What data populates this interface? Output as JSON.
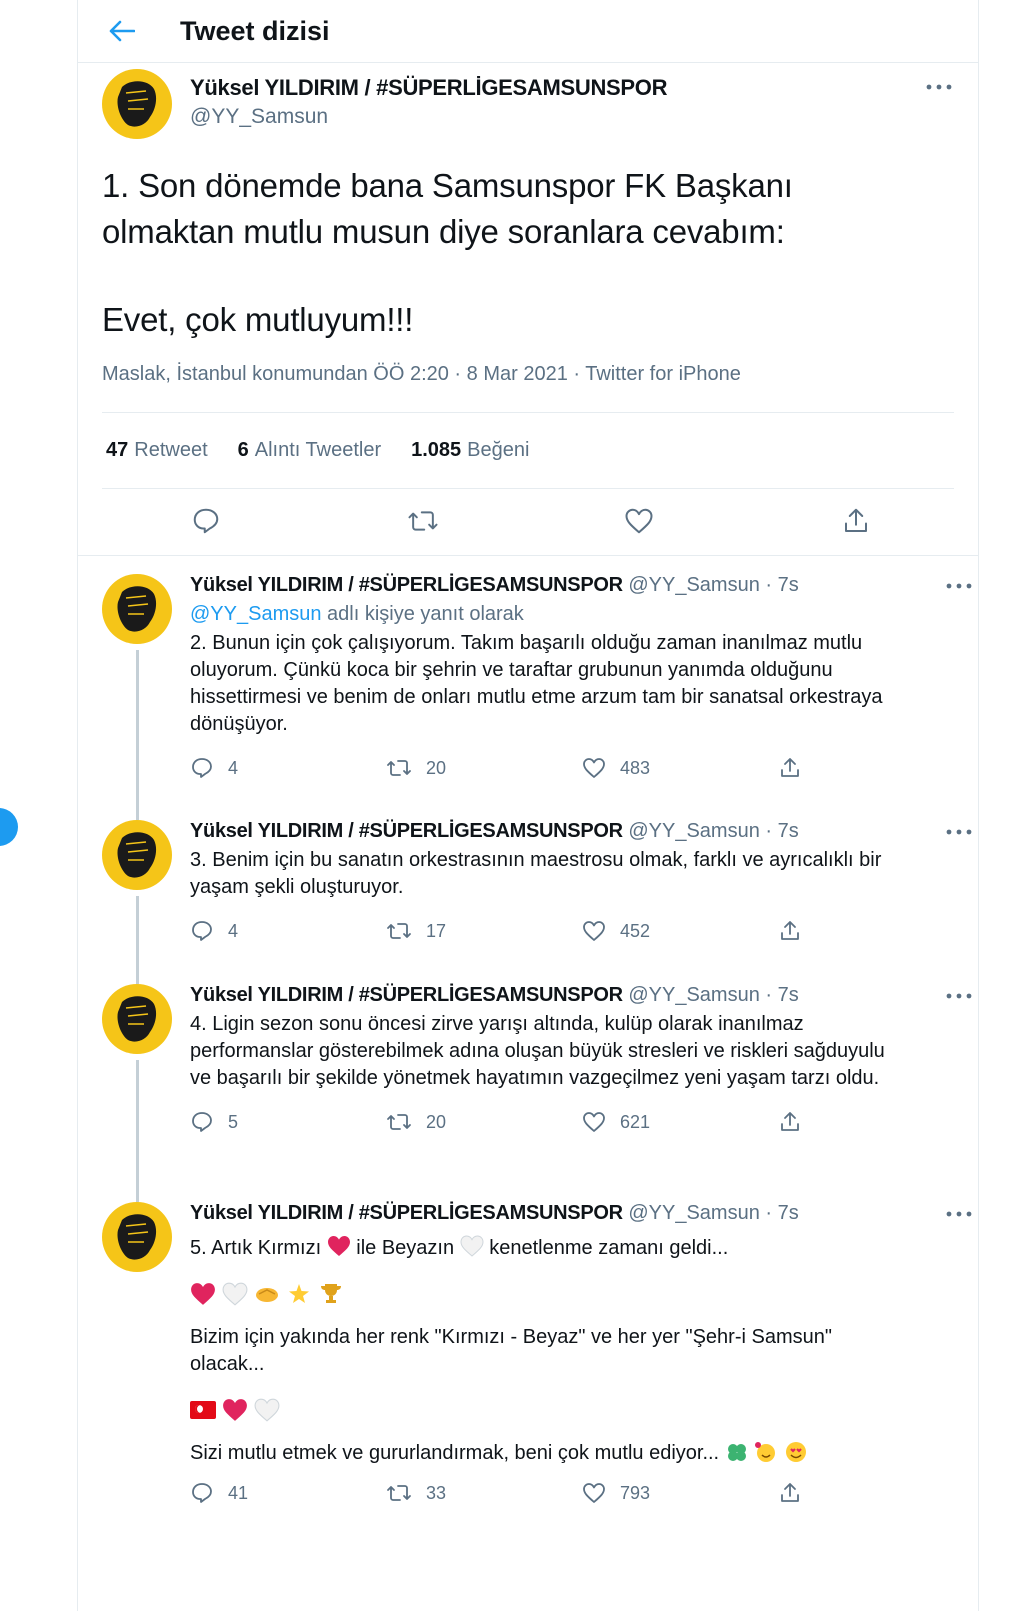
{
  "header": {
    "title": "Tweet dizisi"
  },
  "main_tweet": {
    "display_name": "Yüksel YILDIRIM / #SÜPERLİGESAMSUNSPOR",
    "handle": "@YY_Samsun",
    "text_line1": "1. Son dönemde bana Samsunspor FK Başkanı",
    "text_line2": "olmaktan mutlu musun diye soranlara cevabım:",
    "text_line3": "Evet, çok mutluyum!!!",
    "meta": "Maslak, İstanbul konumundan ÖÖ 2:20 · 8 Mar 2021 · Twitter for iPhone",
    "stats": {
      "retweets": "47",
      "retweets_label": "Retweet",
      "quotes": "6",
      "quotes_label": "Alıntı Tweetler",
      "likes": "1.085",
      "likes_label": "Beğeni"
    }
  },
  "replies": [
    {
      "display_name": "Yüksel YILDIRIM / #SÜPERLİGESAMSUNSPOR",
      "handle_time": "@YY_Samsun · 7s",
      "replying_prefix": "@YY_Samsun",
      "replying_suffix": " adlı kişiye yanıt olarak",
      "text": "2. Bunun için çok çalışıyorum. Takım başarılı olduğu zaman inanılmaz mutlu oluyorum. Çünkü koca bir şehrin ve taraftar grubunun yanımda olduğunu hissettirmesi ve benim de onları mutlu etme arzum tam bir sanatsal orkestraya dönüşüyor.",
      "replies": "4",
      "retweets": "20",
      "likes": "483"
    },
    {
      "display_name": "Yüksel YILDIRIM / #SÜPERLİGESAMSUNSPOR",
      "handle_time": "@YY_Samsun · 7s",
      "text": "3. Benim için bu sanatın orkestrasının maestrosu olmak, farklı ve ayrıcalıklı bir yaşam şekli oluşturuyor.",
      "replies": "4",
      "retweets": "17",
      "likes": "452"
    },
    {
      "display_name": "Yüksel YILDIRIM / #SÜPERLİGESAMSUNSPOR",
      "handle_time": "@YY_Samsun · 7s",
      "text": "4. Ligin sezon sonu öncesi zirve yarışı altında, kulüp olarak inanılmaz performanslar gösterebilmek adına oluşan büyük stresleri ve riskleri sağduyulu ve başarılı bir şekilde yönetmek hayatımın vazgeçilmez yeni yaşam tarzı oldu.",
      "replies": "5",
      "retweets": "20",
      "likes": "621"
    },
    {
      "display_name": "Yüksel YILDIRIM / #SÜPERLİGESAMSUNSPOR",
      "handle_time": "@YY_Samsun · 7s",
      "text_a1": "5. Artık Kırmızı",
      "text_a2": "ile Beyazın",
      "text_a3": "kenetlenme zamanı geldi...",
      "text_b": "Bizim için yakında her renk \"Kırmızı - Beyaz\" ve her yer \"Şehr-i Samsun\" olacak...",
      "text_c": "Sizi mutlu etmek ve gururlandırmak, beni çok mutlu ediyor...",
      "replies": "41",
      "retweets": "33",
      "likes": "793"
    }
  ],
  "colors": {
    "accent": "#1d9bf0",
    "avatar_bg": "#f5c518",
    "muted": "#5b7083",
    "heart": "#e0245e"
  },
  "icons": [
    "back-arrow-icon",
    "more-icon",
    "reply-icon",
    "retweet-icon",
    "like-icon",
    "share-icon"
  ]
}
